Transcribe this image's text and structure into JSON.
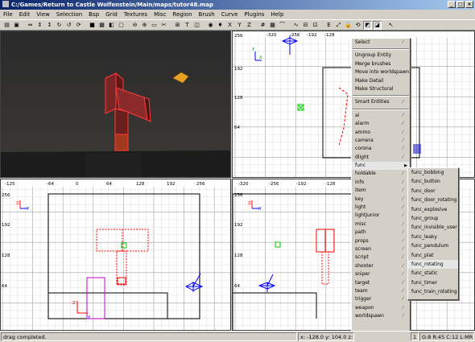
{
  "window": {
    "title": "C:/Games/Return to Castle Wolfenstein/Main/maps/tutor48.map",
    "buttons": [
      "_",
      "□",
      "×"
    ]
  },
  "menubar": [
    "File",
    "Edit",
    "View",
    "Selection",
    "Bsp",
    "Grid",
    "Textures",
    "Misc",
    "Region",
    "Brush",
    "Curve",
    "Plugins",
    "Help"
  ],
  "toolbar": {
    "icons": [
      "open-file-icon",
      "save-file-icon",
      "separator",
      "flip-x-icon",
      "flip-y-icon",
      "flip-z-icon",
      "rotate-x-icon",
      "rotate-y-icon",
      "rotate-z-icon",
      "separator",
      "select-complete-icon",
      "select-touching-icon",
      "select-partial-icon",
      "select-inside-icon",
      "separator",
      "csg-subtract-icon",
      "csg-merge-icon",
      "hollow-icon",
      "clipper-icon",
      "separator",
      "change-view-icon",
      "texture-view-icon",
      "cubic-clip-icon",
      "separator",
      "camera-icon",
      "entity-icon",
      "x-view-icon",
      "y-view-icon",
      "z-view-icon",
      "separator",
      "grid-icon",
      "patch-icon",
      "bend-icon",
      "separator",
      "curve-icon",
      "insert-icon",
      "drill-icon",
      "separator",
      "show-entities-icon",
      "scale-icon",
      "texture-lock-icon",
      "rotate-lock-icon",
      "drag-edges-icon",
      "drag-vertices-icon",
      "separator",
      "brush-cursor-icon"
    ],
    "active": [
      42,
      43
    ]
  },
  "views": {
    "top_right": {
      "ruler": [
        "-320",
        "-256",
        "-192",
        "-128"
      ],
      "left_labels": [
        "256",
        "192",
        "128",
        "64"
      ],
      "axes": [
        "X",
        "Y"
      ]
    },
    "bottom_left": {
      "ruler": [
        "-125",
        "-64",
        "0",
        "64",
        "128",
        "192",
        "256"
      ],
      "left_labels": [
        "256",
        "192",
        "128",
        "64"
      ],
      "axes": [
        "Z",
        "Y",
        "Z",
        "Y"
      ]
    },
    "bottom_right": {
      "ruler": [
        "-320",
        "-256",
        "-192",
        "-128"
      ],
      "left_labels": [
        "256",
        "192",
        "128",
        "64"
      ],
      "axes": [
        "Z",
        "X"
      ]
    }
  },
  "context_menu": {
    "group1": [
      "Select"
    ],
    "group2": [
      "Ungroup Entity",
      "Merge brushes",
      "Move into worldspawn",
      "Make Detail",
      "Make Structural"
    ],
    "group3": [
      "Smart Entities"
    ],
    "entities": [
      "ai",
      "alarm",
      "ammo",
      "camera",
      "corona",
      "dlight",
      "func",
      "holdable",
      "info",
      "item",
      "key",
      "light",
      "lightJunior",
      "misc",
      "path",
      "props",
      "screen",
      "script",
      "shooter",
      "sniper",
      "target",
      "team",
      "trigger",
      "weapon",
      "worldspawn"
    ]
  },
  "submenu": {
    "items": [
      "func_bobbing",
      "func_button",
      "func_door",
      "func_door_rotating",
      "func_explosive",
      "func_group",
      "func_invisible_user",
      "func_leaky",
      "func_pendulum",
      "func_plat",
      "func_rotating",
      "func_static",
      "func_timer",
      "func_train_rotating"
    ],
    "highlighted": "func_rotating"
  },
  "status": {
    "message": "drag completed.",
    "coords": "x: -128.0  y: 104.0  z:",
    "extra": "1",
    "grid": "G:8 R:45 C:12 L:MR"
  },
  "colors": {
    "selection": "#ff0000",
    "axis_x": "#0000ff",
    "axis_z": "#ff0000",
    "menu_bg": "#d4d0c8",
    "grid_major": "#a0a0a0",
    "grid_minor": "#e3e3e3"
  }
}
